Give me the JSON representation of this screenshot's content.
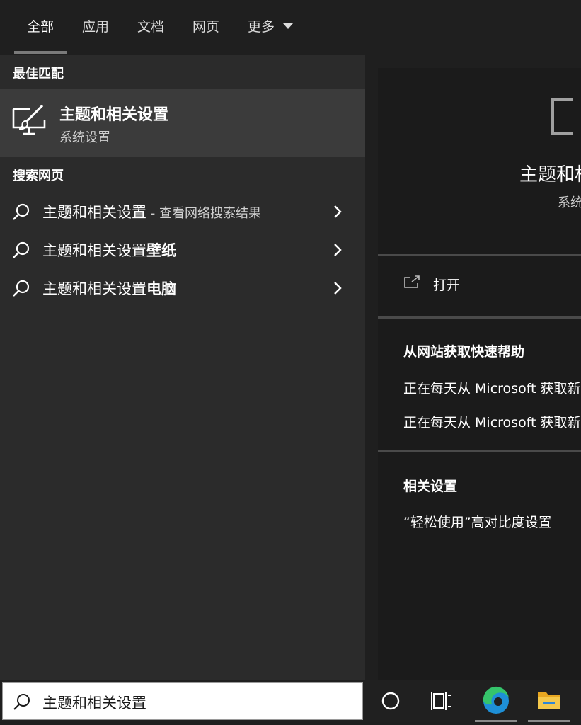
{
  "tabs": [
    {
      "label": "全部",
      "active": true
    },
    {
      "label": "应用",
      "active": false
    },
    {
      "label": "文档",
      "active": false
    },
    {
      "label": "网页",
      "active": false
    },
    {
      "label": "更多",
      "active": false
    }
  ],
  "left": {
    "best_match_heading": "最佳匹配",
    "best_match": {
      "title": "主题和相关设置",
      "subtitle": "系统设置",
      "icon": "personalization-brush-icon"
    },
    "web_heading": "搜索网页",
    "web_results": [
      {
        "query": "主题和相关设置",
        "suffix": "",
        "hint": " - 查看网络搜索结果"
      },
      {
        "query": "主题和相关设置",
        "suffix": "壁纸",
        "hint": ""
      },
      {
        "query": "主题和相关设置",
        "suffix": "电脑",
        "hint": ""
      }
    ]
  },
  "right": {
    "preview_title": "主题和相关设置",
    "preview_subtitle": "系统设置",
    "open_label": "打开",
    "help_heading": "从网站获取快速帮助",
    "help_links": [
      "正在每天从 Microsoft 获取新",
      "正在每天从 Microsoft 获取新"
    ],
    "related_heading": "相关设置",
    "related_links": [
      "“轻松使用”高对比度设置"
    ]
  },
  "taskbar": {
    "search_value": "主题和相关设置",
    "buttons": [
      "cortana-icon",
      "task-view-icon",
      "edge-icon",
      "file-explorer-icon"
    ]
  },
  "colors": {
    "background": "#1f1f1f",
    "left_panel": "#2b2b2b",
    "selected_row": "#3b3b3b",
    "accent_edge": "#1e8fd6"
  }
}
